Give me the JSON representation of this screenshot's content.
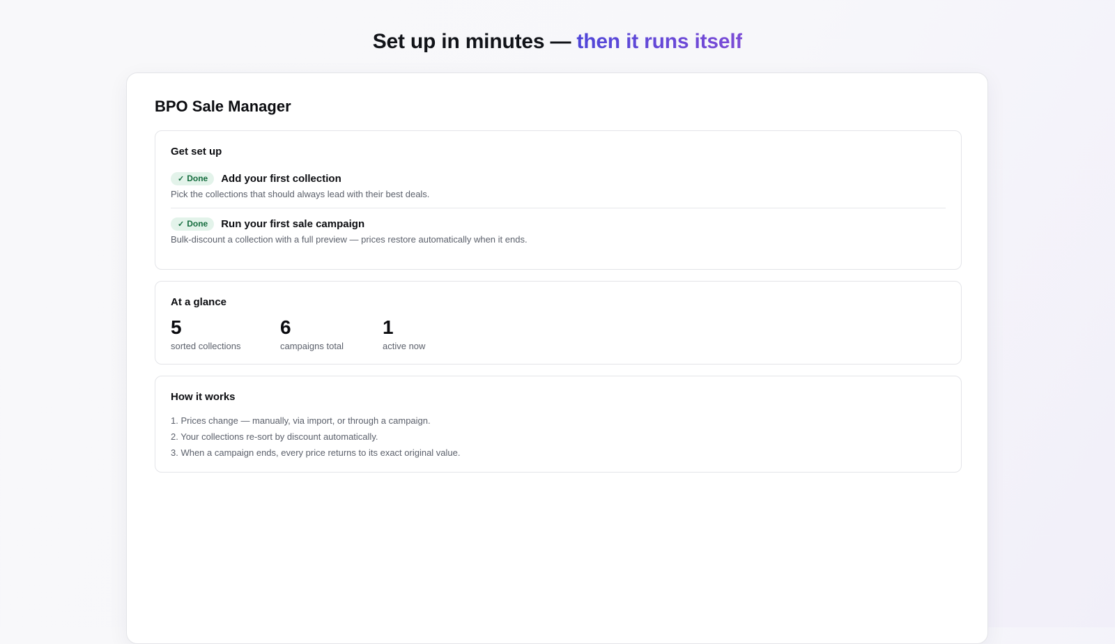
{
  "hero": {
    "title_main": "Set up in minutes — ",
    "title_accent": "then it runs itself",
    "accent_gradient": [
      "#4f46d8",
      "#7b4bd6"
    ]
  },
  "app": {
    "title": "BPO Sale Manager"
  },
  "setup": {
    "title": "Get set up",
    "steps": [
      {
        "status": "Done",
        "status_icon": "check-icon",
        "status_glyph": "✓",
        "title": "Add your first collection",
        "description": "Pick the collections that should always lead with their best deals."
      },
      {
        "status": "Done",
        "status_icon": "check-icon",
        "status_glyph": "✓",
        "title": "Run your first sale campaign",
        "description": "Bulk-discount a collection with a full preview — prices restore automatically when it ends."
      }
    ]
  },
  "glance": {
    "title": "At a glance",
    "stats": [
      {
        "value": "5",
        "label": "sorted collections"
      },
      {
        "value": "6",
        "label": "campaigns total"
      },
      {
        "value": "1",
        "label": "active now"
      }
    ]
  },
  "how": {
    "title": "How it works",
    "items": [
      "1. Prices change — manually, via import, or through a campaign.",
      "2. Your collections re-sort by discount automatically.",
      "3. When a campaign ends, every price returns to its exact original value."
    ]
  },
  "colors": {
    "done_badge_bg": "#e3f3ea",
    "done_badge_text": "#146c3d"
  }
}
